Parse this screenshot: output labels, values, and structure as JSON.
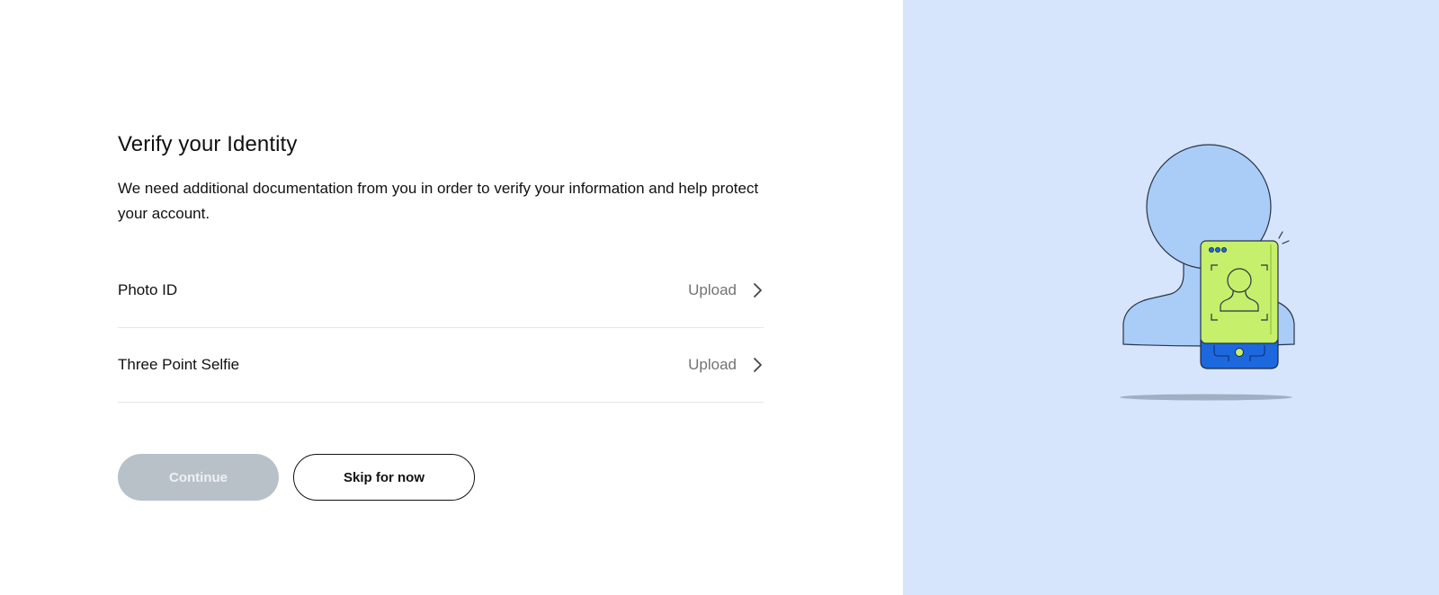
{
  "header": {
    "title": "Verify your Identity",
    "description": "We need additional documentation from you in order to verify your information and help protect your account."
  },
  "documents": [
    {
      "label": "Photo ID",
      "action": "Upload"
    },
    {
      "label": "Three Point Selfie",
      "action": "Upload"
    }
  ],
  "buttons": {
    "continue_label": "Continue",
    "skip_label": "Skip for now"
  },
  "colors": {
    "panel_background": "#d6e4fc",
    "bust": "#a9cdf7",
    "phone_screen": "#c6ef6b",
    "phone_base": "#1d68de",
    "continue_disabled": "#b9c1c8"
  },
  "icons": {
    "row_chevron": "chevron-right-icon",
    "illustration": "identity-verification-illustration"
  }
}
